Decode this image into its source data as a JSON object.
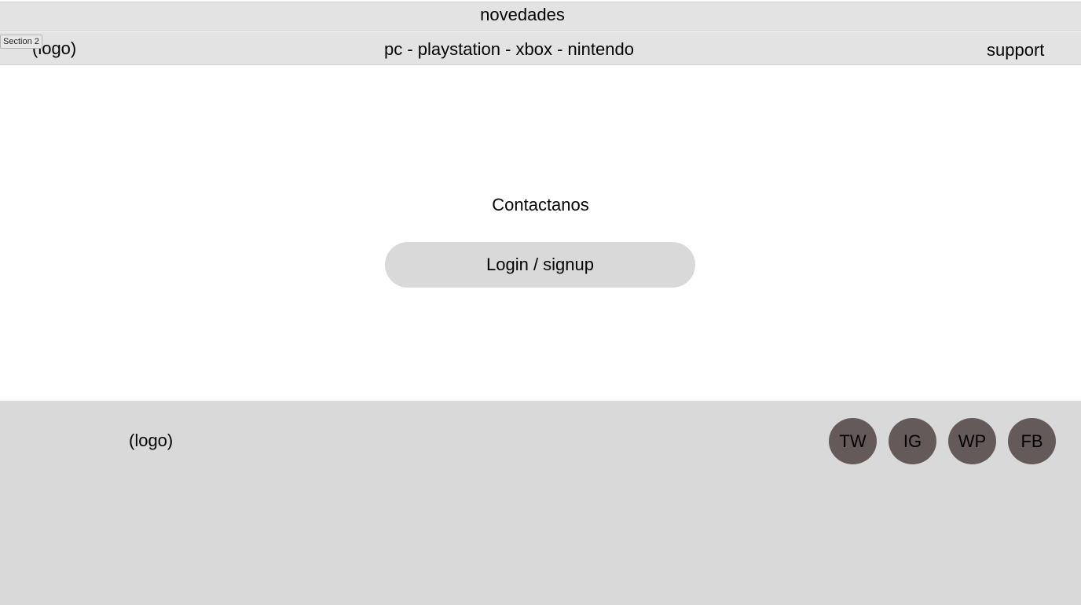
{
  "topbar": {
    "news_link": "novedades"
  },
  "section_tag": "Section 2",
  "nav": {
    "logo": "(logo)",
    "platforms": "pc - playstation - xbox - nintendo",
    "support": "support"
  },
  "main": {
    "contact_title": "Contactanos",
    "login_button": "Login / signup"
  },
  "footer": {
    "logo": "(logo)",
    "social": [
      {
        "label": "TW",
        "icon": "twitter-icon"
      },
      {
        "label": "IG",
        "icon": "instagram-icon"
      },
      {
        "label": "WP",
        "icon": "whatsapp-icon"
      },
      {
        "label": "FB",
        "icon": "facebook-icon"
      }
    ]
  },
  "colors": {
    "bar_background": "#e3e3e3",
    "footer_background": "#d9d9d9",
    "button_background": "#d9d9d9",
    "social_circle": "#645a5a"
  }
}
